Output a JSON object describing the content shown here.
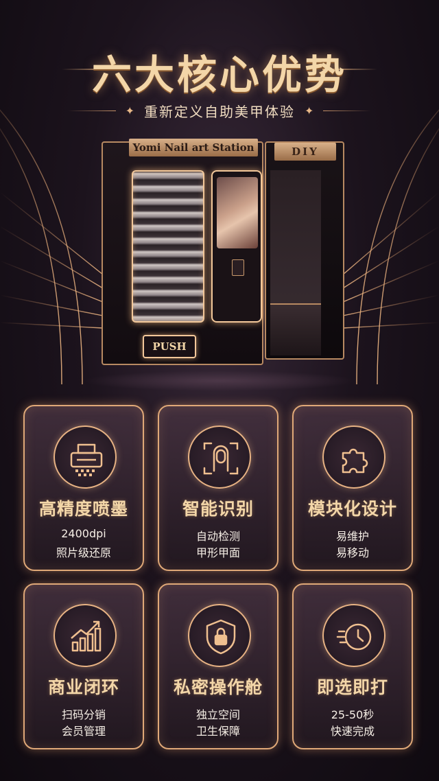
{
  "header": {
    "title": "六大核心优势",
    "subtitle": "重新定义自助美甲体验",
    "star_glyph": "✦"
  },
  "machine": {
    "sign": "Yomi Nail art Station",
    "diy_sign": "DIY",
    "push_label": "PUSH"
  },
  "features": [
    {
      "icon": "printer-icon",
      "title": "高精度喷墨",
      "line1": "2400dpi",
      "line2": "照片级还原"
    },
    {
      "icon": "finger-scan-icon",
      "title": "智能识别",
      "line1": "自动检测",
      "line2": "甲形甲面"
    },
    {
      "icon": "puzzle-icon",
      "title": "模块化设计",
      "line1": "易维护",
      "line2": "易移动"
    },
    {
      "icon": "growth-chart-icon",
      "title": "商业闭环",
      "line1": "扫码分销",
      "line2": "会员管理"
    },
    {
      "icon": "shield-lock-icon",
      "title": "私密操作舱",
      "line1": "独立空间",
      "line2": "卫生保障"
    },
    {
      "icon": "fast-clock-icon",
      "title": "即选即打",
      "line1": "25-50秒",
      "line2": "快速完成"
    }
  ],
  "colors": {
    "accent_gold": "#e0a978",
    "title_gold": "#f3d6a8",
    "background": "#1c131d"
  }
}
